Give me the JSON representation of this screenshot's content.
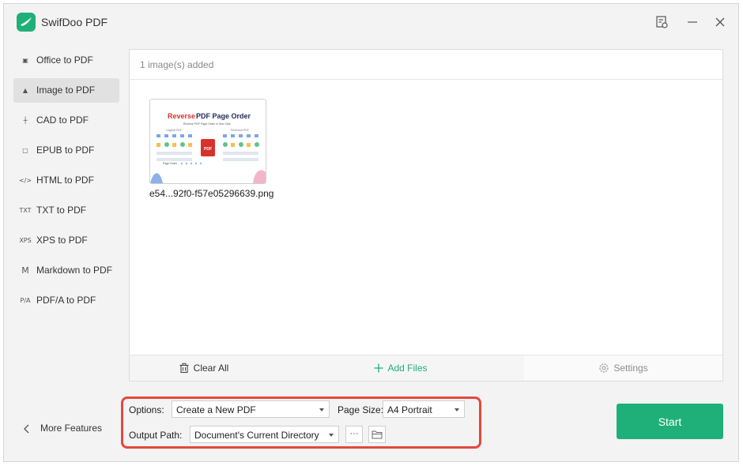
{
  "app": {
    "title": "SwifDoo PDF",
    "accent": "#1fb07a",
    "highlight": "#e5483c"
  },
  "titlebar": {
    "icons": [
      "task-list-icon",
      "minimize-icon",
      "close-icon"
    ]
  },
  "sidebar": {
    "items": [
      {
        "label": "Office to PDF",
        "icon": "office-icon",
        "glyph": "▣",
        "active": false
      },
      {
        "label": "Image to PDF",
        "icon": "image-icon",
        "glyph": "▲",
        "active": true
      },
      {
        "label": "CAD to PDF",
        "icon": "cad-icon",
        "glyph": "┼",
        "active": false
      },
      {
        "label": "EPUB to PDF",
        "icon": "epub-icon",
        "glyph": "▢",
        "active": false
      },
      {
        "label": "HTML to PDF",
        "icon": "html-icon",
        "glyph": "</>",
        "active": false
      },
      {
        "label": "TXT to PDF",
        "icon": "txt-icon",
        "glyph": "TXT",
        "active": false
      },
      {
        "label": "XPS to PDF",
        "icon": "xps-icon",
        "glyph": "XPS",
        "active": false
      },
      {
        "label": "Markdown to PDF",
        "icon": "markdown-icon",
        "glyph": "M",
        "active": false
      },
      {
        "label": "PDF/A to PDF",
        "icon": "pdfa-icon",
        "glyph": "P/A",
        "active": false
      }
    ],
    "more_features": "More Features"
  },
  "panel": {
    "count_text": "1 image(s) added",
    "files": [
      {
        "name": "e54...92f0-f57e05296639.png",
        "thumb_title_red": "Reverse",
        "thumb_title_rest": " PDF Page Order",
        "thumb_subtitle": "Reverse PDF Page Order in One Click",
        "thumb_left_label": "Original PDF",
        "thumb_right_label": "Reversed PDF",
        "thumb_bottom_label": "Page Order"
      }
    ],
    "footer": {
      "clear_all": "Clear All",
      "add_files": "Add Files",
      "settings": "Settings"
    }
  },
  "options": {
    "options_label": "Options:",
    "options_value": "Create a New PDF",
    "page_size_label": "Page Size:",
    "page_size_value": "A4 Portrait",
    "output_label": "Output Path:",
    "output_value": "Document's Current Directory",
    "more_button": "···"
  },
  "start_label": "Start"
}
